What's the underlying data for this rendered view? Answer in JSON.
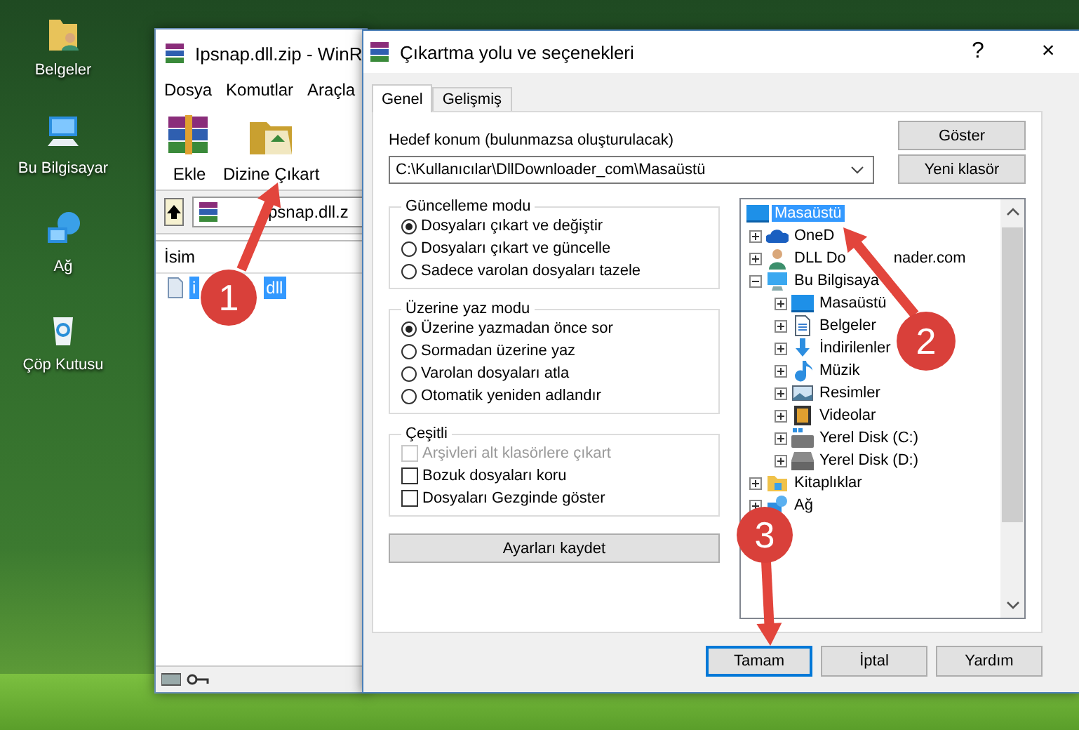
{
  "desktop_icons": [
    {
      "label": "Belgeler"
    },
    {
      "label": "Bu Bilgisayar"
    },
    {
      "label": "Ağ"
    },
    {
      "label": "Çöp Kutusu"
    }
  ],
  "archive_window": {
    "title": "Ipsnap.dll.zip - WinR",
    "menu": [
      "Dosya",
      "Komutlar",
      "Araçla"
    ],
    "toolbar": [
      {
        "label": "Ekle"
      },
      {
        "label": "Dizine Çıkart"
      }
    ],
    "path": "psnap.dll.z",
    "columns": [
      "İsim"
    ],
    "files": [
      {
        "name": "i",
        "name_end": "dll",
        "selected": true
      }
    ]
  },
  "dialog": {
    "title": "Çıkartma yolu ve seçenekleri",
    "title_buttons": [
      "?",
      "×"
    ],
    "tabs": [
      {
        "label": "Genel",
        "selected": true
      },
      {
        "label": "Gelişmiş",
        "selected": false
      }
    ],
    "destination_label": "Hedef konum (bulunmazsa oluşturulacak)",
    "destination": "C:\\Kullanıcılar\\DllDownloader_com\\Masaüstü",
    "side_buttons": [
      "Göster",
      "Yeni klasör"
    ],
    "groups": [
      {
        "title": "Güncelleme modu",
        "options": [
          {
            "kind": "radio",
            "label": "Dosyaları çıkart ve değiştir",
            "selected": true
          },
          {
            "kind": "radio",
            "label": "Dosyaları çıkart ve güncelle",
            "selected": false
          },
          {
            "kind": "radio",
            "label": "Sadece varolan dosyaları tazele",
            "selected": false
          }
        ]
      },
      {
        "title": "Üzerine yaz modu",
        "options": [
          {
            "kind": "radio",
            "label": "Üzerine yazmadan önce sor",
            "selected": true
          },
          {
            "kind": "radio",
            "label": "Sormadan üzerine yaz",
            "selected": false
          },
          {
            "kind": "radio",
            "label": "Varolan dosyaları atla",
            "selected": false
          },
          {
            "kind": "radio",
            "label": "Otomatik yeniden adlandır",
            "selected": false
          }
        ]
      },
      {
        "title": "Çeşitli",
        "options": [
          {
            "kind": "checkbox",
            "label": "Arşivleri alt klasörlere çıkart",
            "checked": false,
            "disabled": true
          },
          {
            "kind": "checkbox",
            "label": "Bozuk dosyaları koru",
            "checked": false,
            "disabled": false
          },
          {
            "kind": "checkbox",
            "label": "Dosyaları Gezginde göster",
            "checked": false,
            "disabled": false
          }
        ]
      }
    ],
    "save_button": "Ayarları kaydet",
    "tree": [
      {
        "label": "Masaüstü",
        "selected": true,
        "children": [
          {
            "label": "OneD",
            "expanded": false,
            "selected": false
          },
          {
            "label": "DLL Do",
            "label_end": "nader.com",
            "expanded": false,
            "selected": false
          },
          {
            "label": "Bu Bilgisaya",
            "expanded": true,
            "selected": false,
            "children": [
              {
                "label": "Masaüstü",
                "expanded": false,
                "selected": false
              },
              {
                "label": "Belgeler",
                "expanded": false,
                "selected": false
              },
              {
                "label": "İndirilenler",
                "expanded": false,
                "selected": false
              },
              {
                "label": "Müzik",
                "expanded": false,
                "selected": false
              },
              {
                "label": "Resimler",
                "expanded": false,
                "selected": false
              },
              {
                "label": "Videolar",
                "expanded": false,
                "selected": false
              },
              {
                "label": "Yerel Disk (C:)",
                "expanded": false,
                "selected": false
              },
              {
                "label": "Yerel Disk (D:)",
                "expanded": false,
                "selected": false
              }
            ]
          },
          {
            "label": "Kitaplıklar",
            "expanded": false,
            "selected": false
          },
          {
            "label": "Ağ",
            "expanded": false,
            "selected": false
          }
        ]
      }
    ],
    "buttons": [
      {
        "label": "Tamam",
        "focused": true
      },
      {
        "label": "İptal",
        "focused": false
      },
      {
        "label": "Yardım",
        "focused": false
      }
    ]
  },
  "annotations": [
    {
      "number": "1"
    },
    {
      "number": "2"
    },
    {
      "number": "3"
    }
  ]
}
